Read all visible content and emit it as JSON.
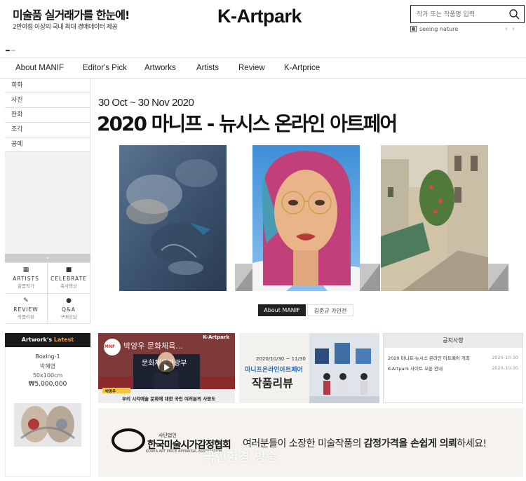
{
  "header": {
    "slogan_main": "미술품 실거래가를 한눈에!",
    "slogan_sub": "2만여점 이상의 국내 최대 경매데이터 제공",
    "logo": "K-Artpark",
    "search_placeholder": "작가 또는 작품명 입력",
    "sponsor": "seeing nature",
    "sponsor_icon": "flag-icon"
  },
  "nav": {
    "items": [
      "About MANIF",
      "Editor's Pick",
      "Artworks",
      "Artists",
      "Review",
      "K-Artprice"
    ]
  },
  "sidebar": {
    "categories": [
      "회화",
      "사진",
      "판화",
      "조각",
      "공예"
    ],
    "quick": [
      {
        "icon": "grid-icon",
        "label": "ARTISTS",
        "sub": "출품작가"
      },
      {
        "icon": "video-icon",
        "label": "CELEBRATE",
        "sub": "축사영상"
      },
      {
        "icon": "pencil-icon",
        "label": "REVIEW",
        "sub": "작품리뷰"
      },
      {
        "icon": "chat-icon",
        "label": "Q&A",
        "sub": "구매상담"
      }
    ]
  },
  "main": {
    "date": "30 Oct ~ 30 Nov 2020",
    "title": "2020 마니프 - 뉴시스 온라인 아트페어",
    "btn_about": "About MANIF",
    "btn_greeting": "김준규 가인전"
  },
  "latest": {
    "title_prefix": "Artwork's",
    "title_accent": "Latest",
    "name": "Boxing-1",
    "artist": "박혜영",
    "size": "50x100cm",
    "price": "₩5,000,000"
  },
  "video": {
    "channel": "K-Artpark",
    "heading": "박양우 문화체육...",
    "sub": "문화체육관광부",
    "caption": "우리 시각예술 문화에 대한 국민 여러분의 사랑도",
    "name_tag": "박양우"
  },
  "review": {
    "date": "2020/10/30 ~ 11/30",
    "line1": "마니프온라인아트페어",
    "line2": "작품리뷰"
  },
  "notice": {
    "title": "공지사항",
    "items": [
      {
        "text": "2020 마니프-뉴시스 온라인 아트페어 개최",
        "date": "2020-10-30"
      },
      {
        "text": "K-Artpark 사이트 오픈 안내",
        "date": "2020-10-30"
      }
    ]
  },
  "banner": {
    "org_small": "사단법인",
    "org_name": "한국미술시가감정협회",
    "org_en": "KOREA ART PRICE APPRAISAL ASSOCIATION",
    "text_pre": "여러분들이 소장한 미술작품의 ",
    "text_bold": "감정가격을 손쉽게 의뢰",
    "text_post": "하세요!",
    "watermark": "국민환경 방송"
  },
  "colors": {
    "accent": "#e8a64c",
    "dark": "#1a1a1a",
    "review_accent": "#2f6fb3"
  }
}
